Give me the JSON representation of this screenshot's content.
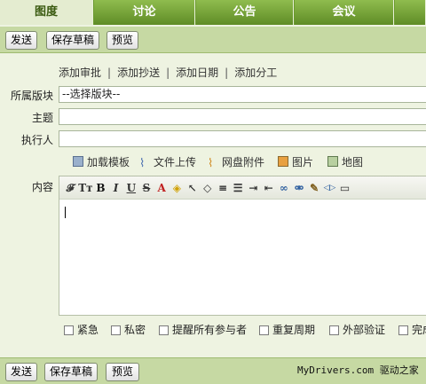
{
  "tabs": [
    {
      "label": "图度",
      "active": true
    },
    {
      "label": "讨论"
    },
    {
      "label": "公告"
    },
    {
      "label": "会议"
    }
  ],
  "toolbar": {
    "send_label": "发送",
    "save_draft_label": "保存草稿",
    "preview_label": "预览"
  },
  "links": [
    "添加审批",
    "添加抄送",
    "添加日期",
    "添加分工"
  ],
  "form": {
    "board_label": "所属版块",
    "board_value": "--选择版块--",
    "subject_label": "主题",
    "subject_value": "",
    "executor_label": "执行人",
    "executor_value": "",
    "content_label": "内容"
  },
  "attachments": [
    {
      "label": "加载模板",
      "icon": "template-icon"
    },
    {
      "label": "文件上传",
      "icon": "paperclip-icon"
    },
    {
      "label": "网盘附件",
      "icon": "paperclip-orange-icon"
    },
    {
      "label": "图片",
      "icon": "image-icon"
    },
    {
      "label": "地图",
      "icon": "map-icon"
    }
  ],
  "editor_tools": [
    {
      "icon": "font-family-icon",
      "glyph": "𝓕"
    },
    {
      "icon": "font-size-icon",
      "glyph": "Tт"
    },
    {
      "icon": "bold-icon",
      "glyph": "B"
    },
    {
      "icon": "italic-icon",
      "glyph": "I"
    },
    {
      "icon": "underline-icon",
      "glyph": "U"
    },
    {
      "icon": "strikethrough-icon",
      "glyph": "S"
    },
    {
      "icon": "text-color-icon",
      "glyph": "A"
    },
    {
      "icon": "highlight-color-icon",
      "glyph": "◈"
    },
    {
      "icon": "pointer-icon",
      "glyph": "↖"
    },
    {
      "icon": "eraser-icon",
      "glyph": "◇"
    },
    {
      "icon": "align-icon",
      "glyph": "≡"
    },
    {
      "icon": "list-icon",
      "glyph": "☰"
    },
    {
      "icon": "indent-icon",
      "glyph": "⇥"
    },
    {
      "icon": "outdent-icon",
      "glyph": "⇤"
    },
    {
      "icon": "link-icon",
      "glyph": "∞"
    },
    {
      "icon": "unlink-icon",
      "glyph": "⚮"
    },
    {
      "icon": "edit-icon",
      "glyph": "✎"
    },
    {
      "icon": "source-code-icon",
      "glyph": "◁▷"
    },
    {
      "icon": "more-icon",
      "glyph": "▭"
    }
  ],
  "options": [
    "紧急",
    "私密",
    "提醒所有参与者",
    "重复周期",
    "外部验证",
    "完成"
  ],
  "footer": {
    "send_label": "发送",
    "save_draft_label": "保存草稿",
    "preview_label": "预览",
    "watermark": "MyDrivers.com 驱动之家"
  },
  "colors": {
    "tab_green": "#6c9a30",
    "toolbar_green": "#c6d9a3",
    "background": "#eef3e1"
  }
}
